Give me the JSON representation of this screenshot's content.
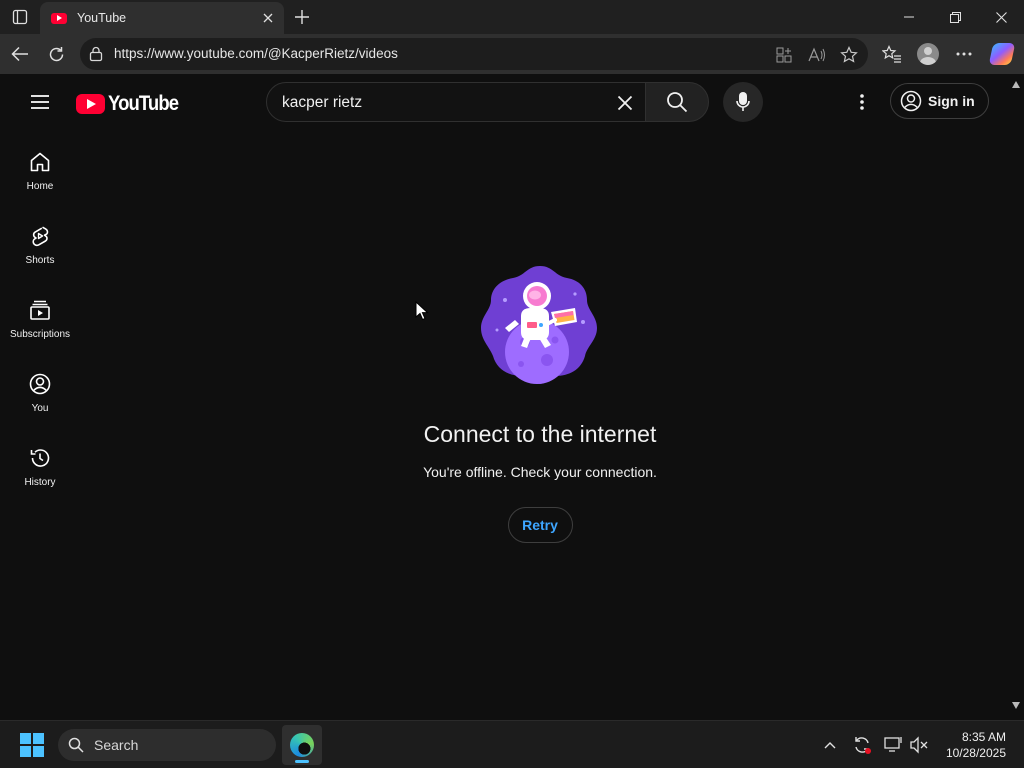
{
  "browser": {
    "tab": {
      "title": "YouTube"
    },
    "url": "https://www.youtube.com/@KacperRietz/videos"
  },
  "header": {
    "search_query": "kacper rietz",
    "sign_in_label": "Sign in"
  },
  "guide": {
    "items": [
      {
        "label": "Home",
        "icon": "home-icon"
      },
      {
        "label": "Shorts",
        "icon": "shorts-icon"
      },
      {
        "label": "Subscriptions",
        "icon": "subscriptions-icon"
      },
      {
        "label": "You",
        "icon": "you-icon"
      },
      {
        "label": "History",
        "icon": "history-icon"
      }
    ]
  },
  "offline": {
    "title": "Connect to the internet",
    "message": "You're offline. Check your connection.",
    "retry_label": "Retry"
  },
  "taskbar": {
    "search_placeholder": "Search",
    "time": "8:35 AM",
    "date": "10/28/2025"
  },
  "colors": {
    "brand_red": "#ff0033",
    "link_blue": "#3ea6ff",
    "page_bg": "#0f0f0f"
  }
}
